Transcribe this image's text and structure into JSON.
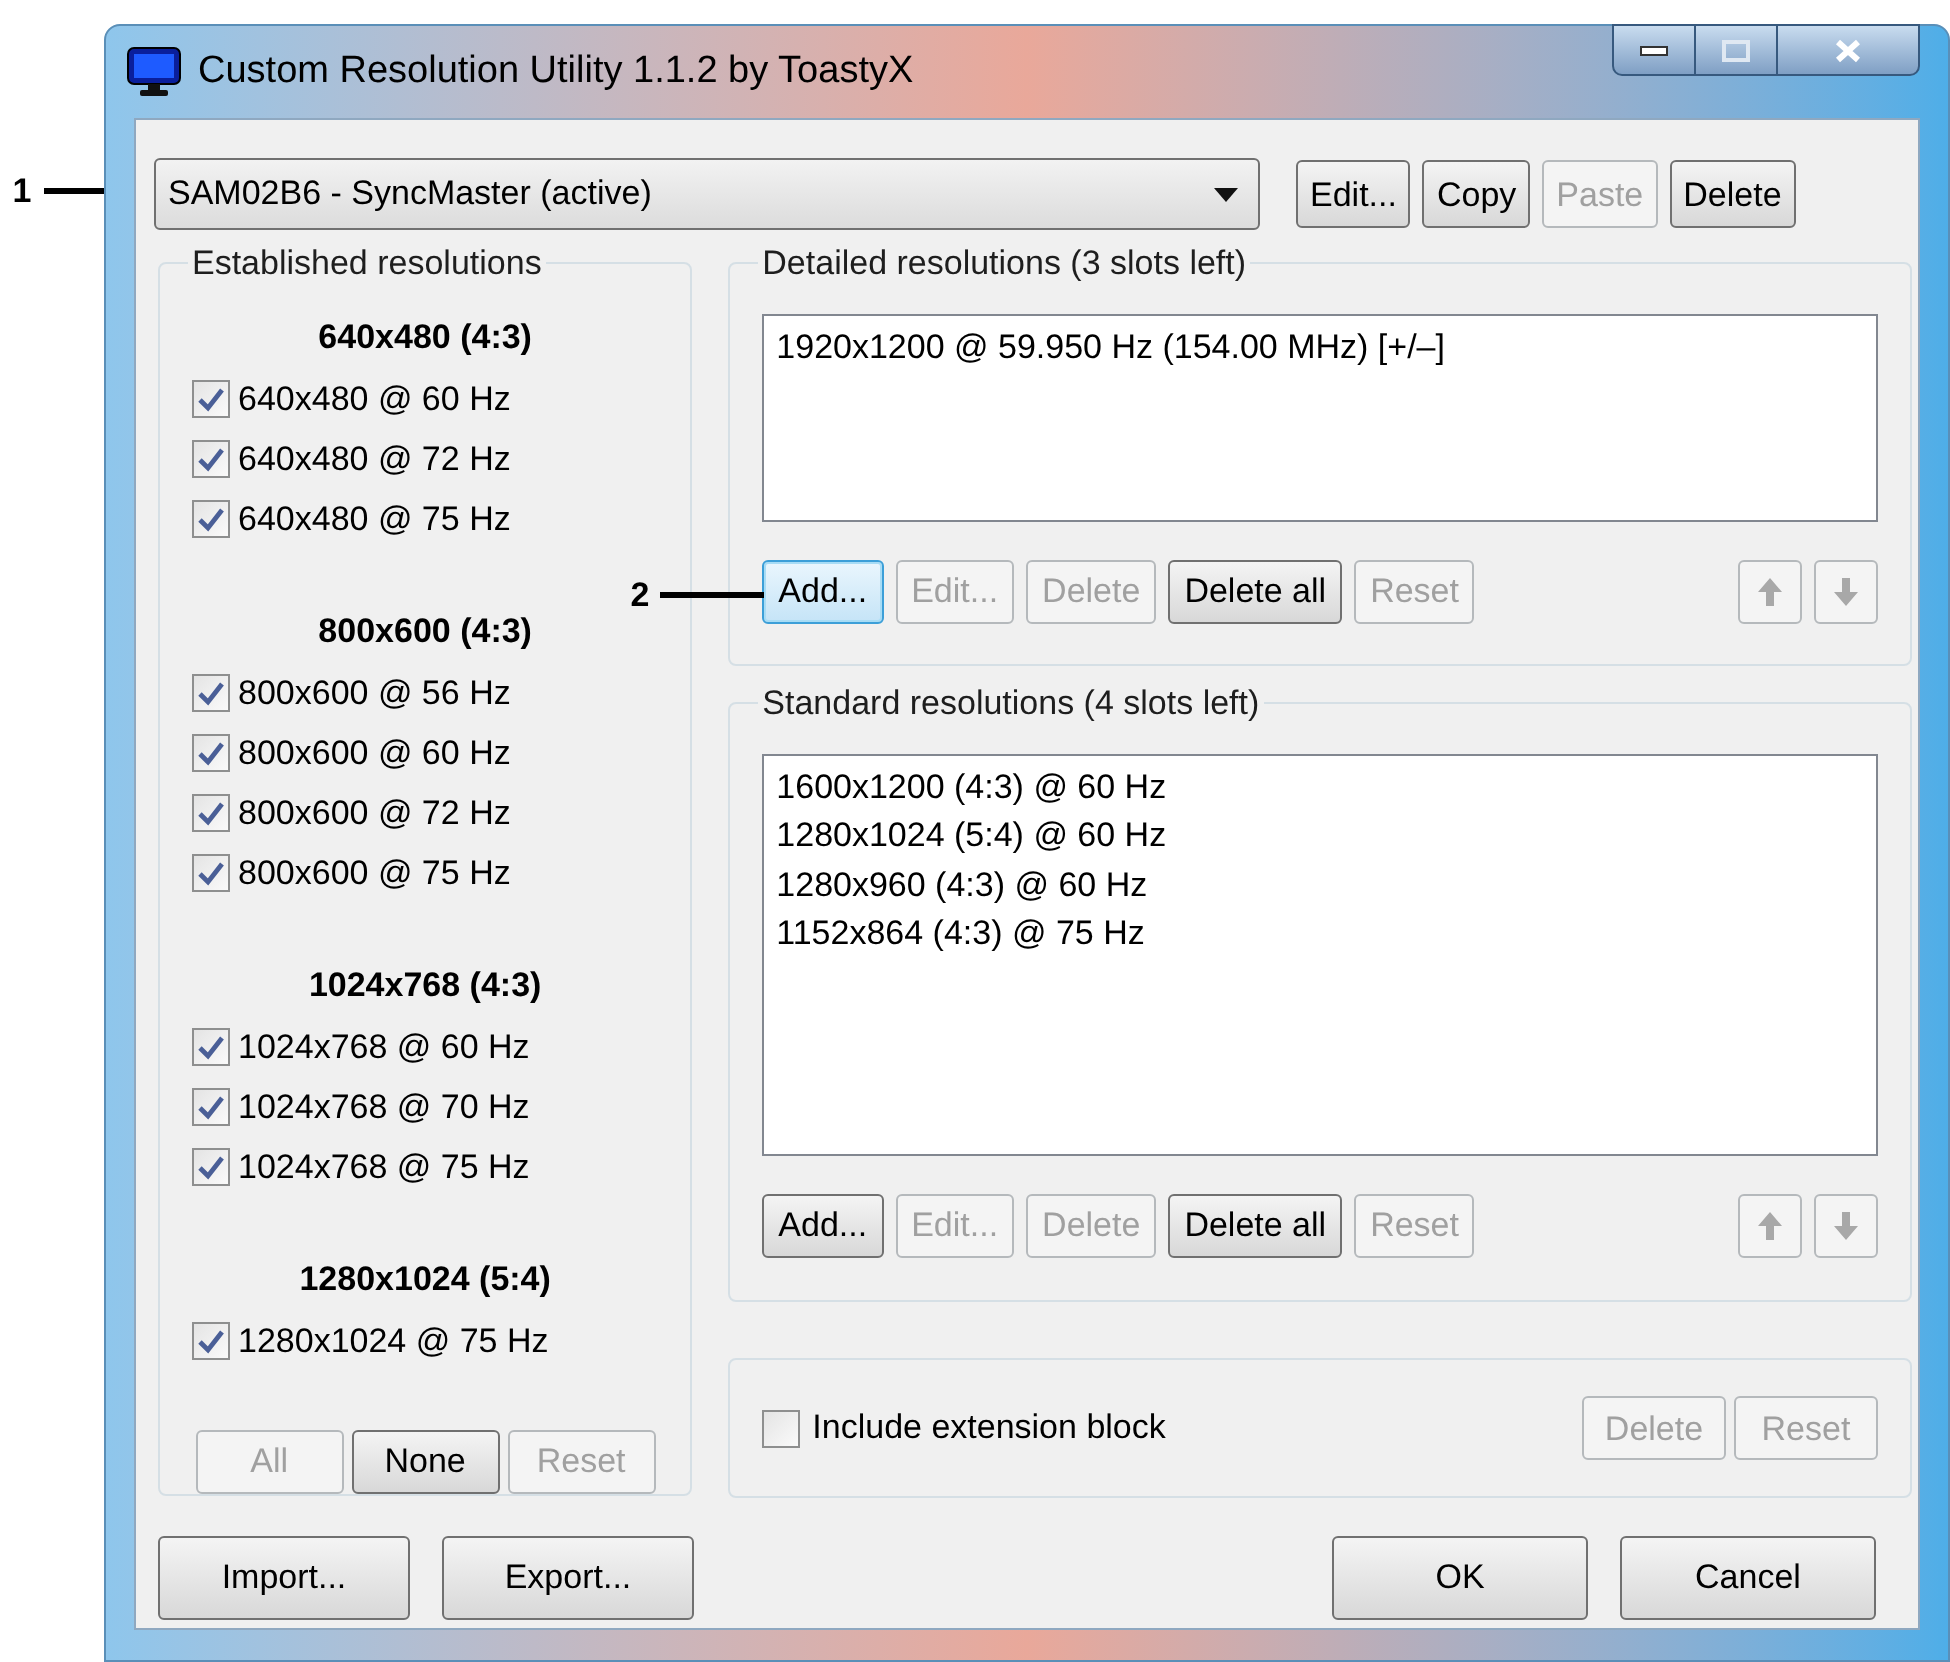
{
  "window": {
    "title": "Custom Resolution Utility 1.1.2 by ToastyX"
  },
  "callouts": [
    "1",
    "2"
  ],
  "monitor_select": {
    "value": "SAM02B6 - SyncMaster (active)"
  },
  "top_buttons": [
    {
      "label": "Edit...",
      "disabled": false
    },
    {
      "label": "Copy",
      "disabled": false
    },
    {
      "label": "Paste",
      "disabled": true
    },
    {
      "label": "Delete",
      "disabled": false
    }
  ],
  "established": {
    "title": "Established resolutions",
    "groups": [
      {
        "heading": "640x480 (4:3)",
        "items": [
          {
            "label": "640x480 @ 60 Hz",
            "checked": true
          },
          {
            "label": "640x480 @ 72 Hz",
            "checked": true
          },
          {
            "label": "640x480 @ 75 Hz",
            "checked": true
          }
        ]
      },
      {
        "heading": "800x600 (4:3)",
        "items": [
          {
            "label": "800x600 @ 56 Hz",
            "checked": true
          },
          {
            "label": "800x600 @ 60 Hz",
            "checked": true
          },
          {
            "label": "800x600 @ 72 Hz",
            "checked": true
          },
          {
            "label": "800x600 @ 75 Hz",
            "checked": true
          }
        ]
      },
      {
        "heading": "1024x768 (4:3)",
        "items": [
          {
            "label": "1024x768 @ 60 Hz",
            "checked": true
          },
          {
            "label": "1024x768 @ 70 Hz",
            "checked": true
          },
          {
            "label": "1024x768 @ 75 Hz",
            "checked": true
          }
        ]
      },
      {
        "heading": "1280x1024 (5:4)",
        "items": [
          {
            "label": "1280x1024 @ 75 Hz",
            "checked": true
          }
        ]
      }
    ],
    "buttons": [
      {
        "label": "All",
        "disabled": true
      },
      {
        "label": "None",
        "disabled": false
      },
      {
        "label": "Reset",
        "disabled": true
      }
    ]
  },
  "detailed": {
    "title": "Detailed resolutions (3 slots left)",
    "list": [
      "1920x1200 @ 59.950 Hz (154.00 MHz) [+/–]"
    ],
    "buttons": [
      {
        "label": "Add...",
        "disabled": false,
        "focused": true
      },
      {
        "label": "Edit...",
        "disabled": true,
        "focused": false
      },
      {
        "label": "Delete",
        "disabled": true,
        "focused": false
      },
      {
        "label": "Delete all",
        "disabled": false,
        "focused": false
      },
      {
        "label": "Reset",
        "disabled": true,
        "focused": false
      }
    ],
    "move_up": {
      "disabled": true
    },
    "move_down": {
      "disabled": true
    }
  },
  "standard": {
    "title": "Standard resolutions (4 slots left)",
    "list": [
      "1600x1200 (4:3) @ 60 Hz",
      "1280x1024 (5:4) @ 60 Hz",
      "1280x960 (4:3) @ 60 Hz",
      "1152x864 (4:3) @ 75 Hz"
    ],
    "buttons": [
      {
        "label": "Add...",
        "disabled": false,
        "focused": false
      },
      {
        "label": "Edit...",
        "disabled": true,
        "focused": false
      },
      {
        "label": "Delete",
        "disabled": true,
        "focused": false
      },
      {
        "label": "Delete all",
        "disabled": false,
        "focused": false
      },
      {
        "label": "Reset",
        "disabled": true,
        "focused": false
      }
    ],
    "move_up": {
      "disabled": true
    },
    "move_down": {
      "disabled": true
    }
  },
  "extension": {
    "label": "Include extension block",
    "checked": false,
    "buttons": [
      {
        "label": "Delete",
        "disabled": true
      },
      {
        "label": "Reset",
        "disabled": true
      }
    ]
  },
  "footer_left": [
    {
      "label": "Import..."
    },
    {
      "label": "Export..."
    }
  ],
  "footer_right": [
    {
      "label": "OK"
    },
    {
      "label": "Cancel"
    }
  ]
}
